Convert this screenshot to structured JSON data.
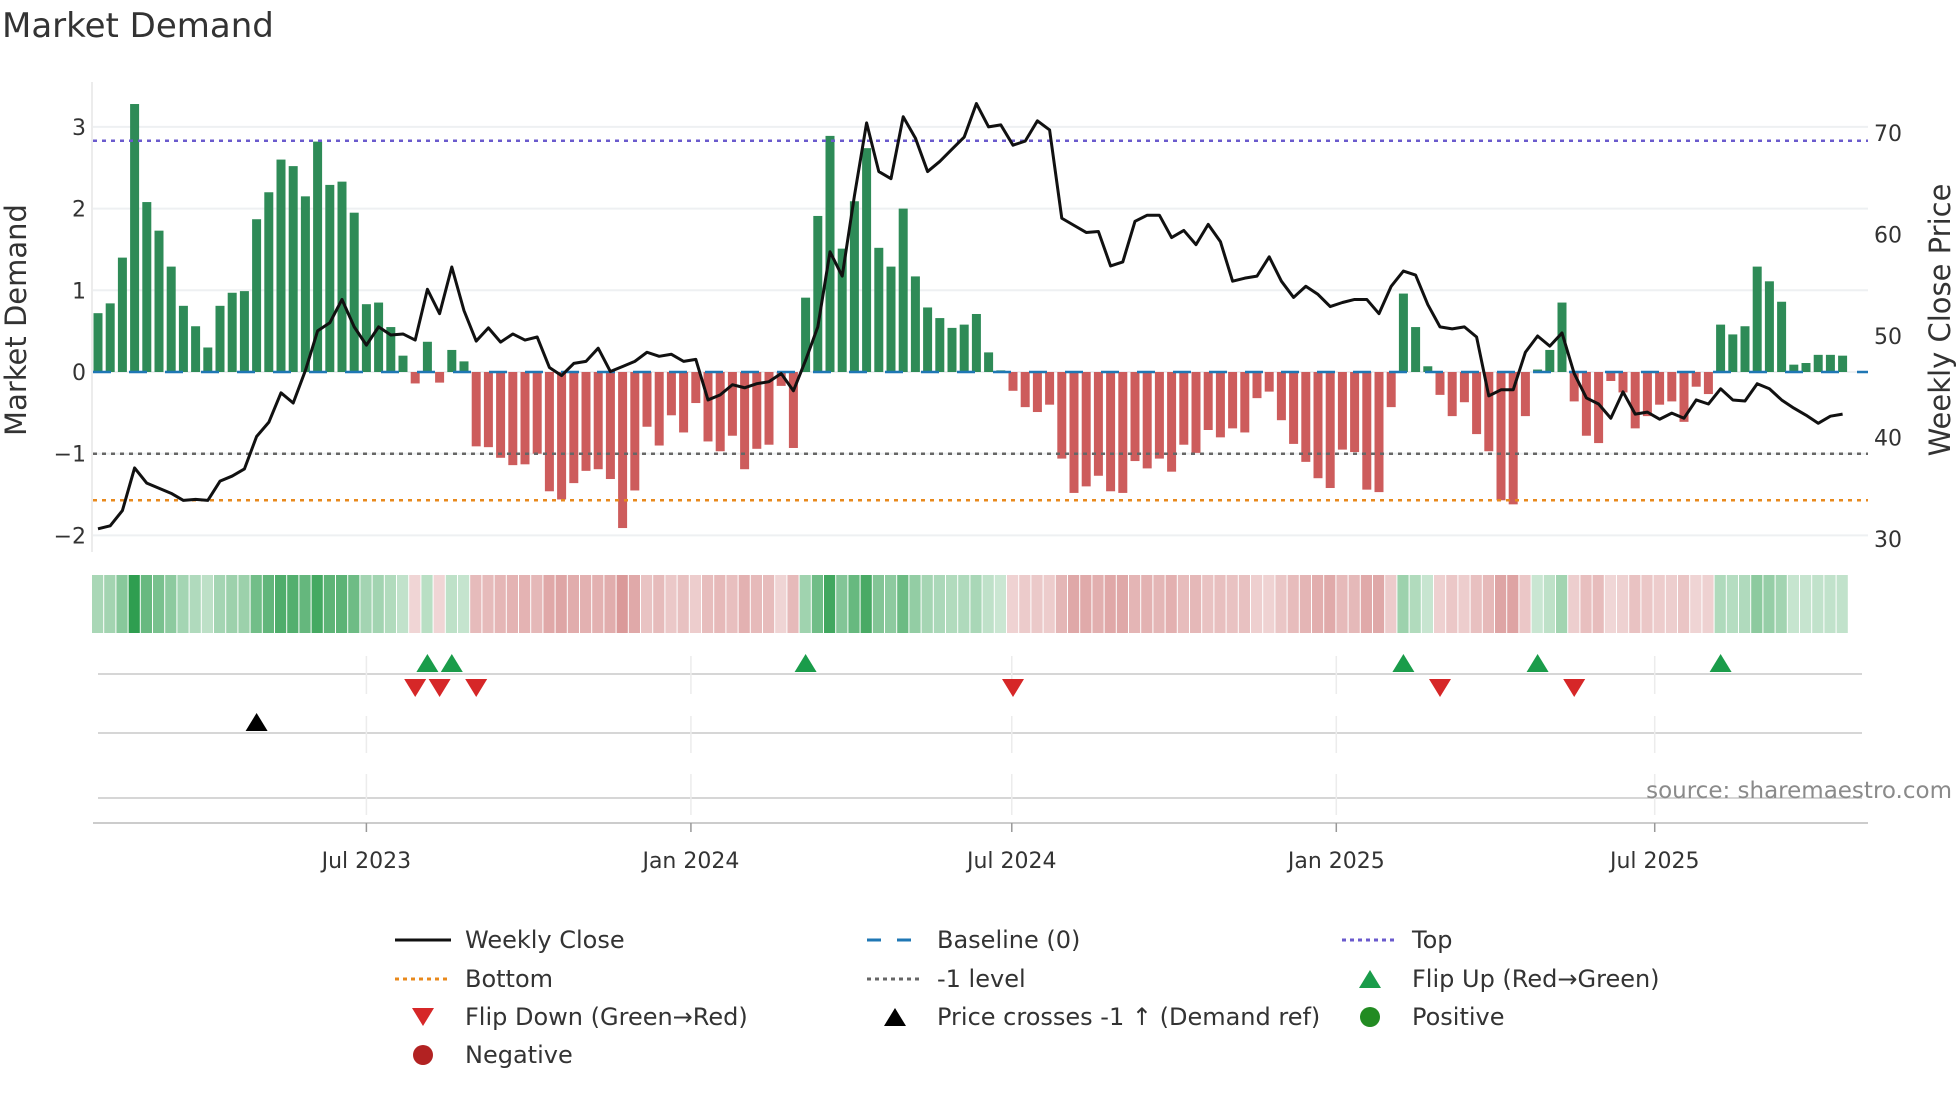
{
  "title": "Market Demand",
  "source": "source: sharemaestro.com",
  "chart_data": {
    "type": "bar",
    "title": "Market Demand",
    "ylabel": "Market Demand",
    "y2label": "Weekly Close Price",
    "ylim": [
      -2.2,
      3.4
    ],
    "y2lim": [
      30,
      73
    ],
    "yticks": [
      3,
      2,
      1,
      0,
      -1,
      -2
    ],
    "ytick_labels": [
      "3",
      "2",
      "1",
      "0",
      "−1",
      "−2"
    ],
    "y2ticks": [
      70,
      60,
      50,
      40,
      30
    ],
    "y2tick_labels": [
      "70",
      "60",
      "50",
      "40",
      "30"
    ],
    "xticks": [
      {
        "label": "Jul 2023",
        "week": 22.0
      },
      {
        "label": "Jan 2024",
        "week": 48.6
      },
      {
        "label": "Jul 2024",
        "week": 74.9
      },
      {
        "label": "Jan 2025",
        "week": 101.5
      },
      {
        "label": "Jul 2025",
        "week": 127.6
      }
    ],
    "levels": {
      "top": 2.83,
      "bottom": -1.57,
      "minus_one": -1,
      "baseline": 0
    },
    "demand": [
      0.72,
      0.84,
      1.4,
      3.28,
      2.08,
      1.73,
      1.29,
      0.81,
      0.56,
      0.3,
      0.81,
      0.97,
      0.99,
      1.87,
      2.2,
      2.6,
      2.52,
      2.15,
      2.82,
      2.29,
      2.33,
      1.95,
      0.83,
      0.85,
      0.55,
      0.2,
      -0.14,
      0.37,
      -0.13,
      0.27,
      0.13,
      -0.91,
      -0.92,
      -1.05,
      -1.14,
      -1.13,
      -1.0,
      -1.46,
      -1.56,
      -1.36,
      -1.21,
      -1.19,
      -1.31,
      -1.91,
      -1.45,
      -0.67,
      -0.9,
      -0.53,
      -0.74,
      -0.38,
      -0.85,
      -0.97,
      -0.78,
      -1.19,
      -0.94,
      -0.89,
      -0.17,
      -0.93,
      0.91,
      1.91,
      2.89,
      1.51,
      2.09,
      2.74,
      1.52,
      1.29,
      2.0,
      1.17,
      0.79,
      0.66,
      0.54,
      0.58,
      0.71,
      0.24,
      0.02,
      -0.23,
      -0.43,
      -0.49,
      -0.4,
      -1.06,
      -1.48,
      -1.4,
      -1.27,
      -1.46,
      -1.48,
      -1.09,
      -1.18,
      -1.06,
      -1.22,
      -0.89,
      -0.99,
      -0.71,
      -0.8,
      -0.69,
      -0.74,
      -0.32,
      -0.24,
      -0.59,
      -0.88,
      -1.1,
      -1.3,
      -1.42,
      -0.95,
      -0.98,
      -1.44,
      -1.47,
      -0.43,
      0.96,
      0.55,
      0.07,
      -0.28,
      -0.54,
      -0.37,
      -0.76,
      -0.97,
      -1.57,
      -1.62,
      -0.54,
      0.03,
      0.27,
      0.85,
      -0.36,
      -0.78,
      -0.87,
      -0.11,
      -0.25,
      -0.69,
      -0.54,
      -0.4,
      -0.36,
      -0.61,
      -0.18,
      -0.27,
      0.58,
      0.46,
      0.56,
      1.29,
      1.11,
      0.86,
      0.09,
      0.11,
      0.21,
      0.21,
      0.2
    ],
    "weekly_close": [
      31.0,
      31.3,
      32.8,
      37.0,
      35.5,
      35.0,
      34.5,
      33.8,
      33.9,
      33.8,
      35.7,
      36.2,
      36.9,
      40.1,
      41.5,
      44.4,
      43.4,
      46.6,
      50.5,
      51.3,
      53.6,
      50.9,
      49.1,
      50.9,
      50.1,
      50.2,
      49.6,
      54.6,
      52.2,
      56.8,
      52.5,
      49.5,
      50.8,
      49.4,
      50.2,
      49.6,
      49.9,
      46.9,
      46.1,
      47.3,
      47.5,
      48.8,
      46.5,
      47.0,
      47.5,
      48.4,
      48.0,
      48.2,
      47.5,
      47.7,
      43.7,
      44.2,
      45.2,
      44.9,
      45.3,
      45.5,
      46.3,
      44.6,
      47.6,
      50.9,
      58.3,
      55.9,
      63.8,
      71.0,
      66.2,
      65.5,
      71.6,
      69.5,
      66.2,
      67.2,
      68.4,
      69.6,
      72.9,
      70.6,
      70.8,
      68.8,
      69.2,
      71.2,
      70.3,
      61.6,
      60.9,
      60.2,
      60.3,
      56.9,
      57.3,
      61.3,
      61.9,
      61.9,
      59.7,
      60.4,
      59.0,
      61.0,
      59.3,
      55.4,
      55.7,
      55.9,
      57.8,
      55.4,
      53.8,
      54.9,
      54.1,
      52.9,
      53.3,
      53.6,
      53.6,
      52.2,
      54.9,
      56.4,
      56.0,
      53.1,
      50.9,
      50.7,
      50.9,
      49.9,
      44.1,
      44.7,
      44.7,
      48.4,
      50.0,
      49.0,
      50.3,
      46.3,
      43.9,
      43.3,
      41.9,
      44.5,
      42.3,
      42.5,
      41.8,
      42.4,
      41.9,
      43.7,
      43.3,
      44.8,
      43.7,
      43.6,
      45.3,
      44.8,
      43.7,
      42.9,
      42.2,
      41.4,
      42.1,
      42.3
    ],
    "events": {
      "flip_up": [
        27,
        29,
        58,
        107,
        118,
        133
      ],
      "flip_down": [
        26,
        28,
        31,
        75,
        110,
        121
      ],
      "price_cross_up": [
        13
      ]
    },
    "legend": [
      {
        "label": "Weekly Close",
        "symbol": "line",
        "color": "#111111"
      },
      {
        "label": "Baseline (0)",
        "symbol": "dash",
        "color": "#1f77b4"
      },
      {
        "label": "Top",
        "symbol": "dot",
        "color": "#6a5acd"
      },
      {
        "label": "Bottom",
        "symbol": "dot",
        "color": "#e8891c"
      },
      {
        "label": "-1 level",
        "symbol": "dot",
        "color": "#666666"
      },
      {
        "label": "Flip Up (Red→Green)",
        "symbol": "tri-up",
        "color": "#1a9c4a"
      },
      {
        "label": "Flip Down (Green→Red)",
        "symbol": "tri-down",
        "color": "#d62728"
      },
      {
        "label": "Price crosses -1 ↑ (Demand ref)",
        "symbol": "tri-up",
        "color": "#000000"
      },
      {
        "label": "Positive",
        "symbol": "circle",
        "color": "#228b22"
      },
      {
        "label": "Negative",
        "symbol": "circle",
        "color": "#b22222"
      }
    ],
    "colors": {
      "positive_bar": "#2e8b57",
      "negative_bar": "#cd5c5c",
      "heat_pos": "#2e9e4f",
      "heat_neg": "#c96a6a"
    }
  }
}
